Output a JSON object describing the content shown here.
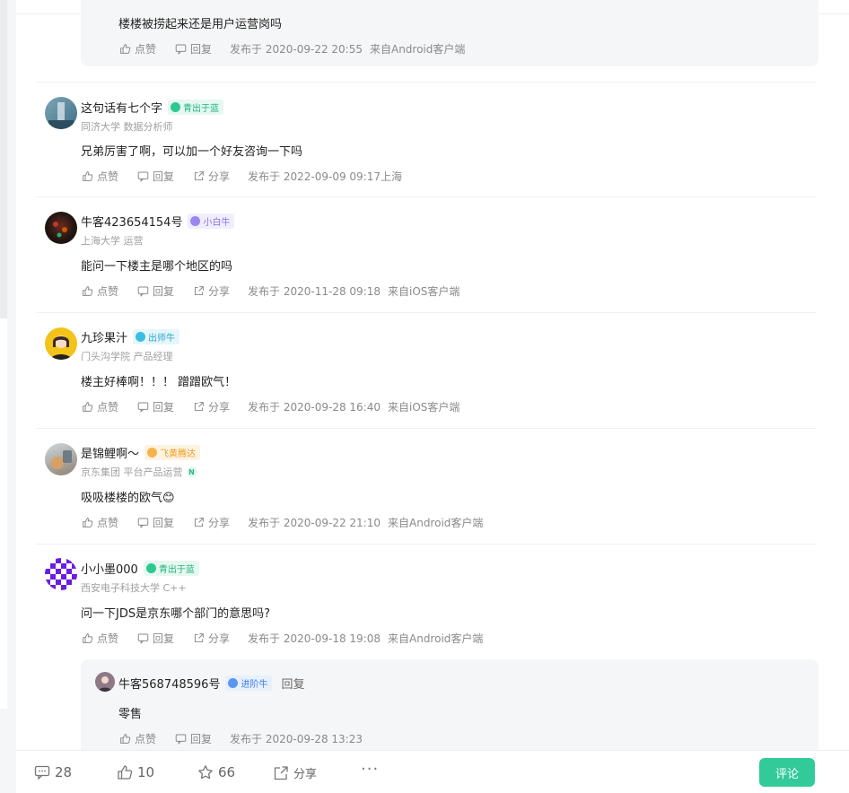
{
  "top_reply": {
    "text": "楼楼被捞起来还是用户运营岗吗",
    "like": "点赞",
    "reply": "回复",
    "time": "发布于 2020-09-22 20:55",
    "source": "来自Android客户端"
  },
  "comments": [
    {
      "name": "这句话有七个字",
      "badge": "青出于蓝",
      "sub": "同济大学 数据分析师",
      "text": "兄弟厉害了啊，可以加一个好友咨询一下吗",
      "like": "点赞",
      "reply": "回复",
      "share": "分享",
      "time": "发布于 2022-09-09 09:17",
      "source": "上海"
    },
    {
      "name": "牛客423654154号",
      "badge": "小白牛",
      "sub": "上海大学 运营",
      "text": "能问一下楼主是哪个地区的吗",
      "like": "点赞",
      "reply": "回复",
      "share": "分享",
      "time": "发布于 2020-11-28 09:18",
      "source": "来自iOS客户端"
    },
    {
      "name": "九珍果汁",
      "badge": "出师牛",
      "sub": "门头沟学院 产品经理",
      "text": "楼主好棒啊！！！ 蹭蹭欧气！",
      "like": "点赞",
      "reply": "回复",
      "share": "分享",
      "time": "发布于 2020-09-28 16:40",
      "source": "来自iOS客户端"
    },
    {
      "name": "是锦鲤啊～",
      "badge": "飞黄腾达",
      "sub": "京东集团  平台产品运营",
      "sub_tag": "N",
      "text": "吸吸楼楼的欧气😊",
      "like": "点赞",
      "reply": "回复",
      "share": "分享",
      "time": "发布于 2020-09-22 21:10",
      "source": "来自Android客户端"
    },
    {
      "name": "小小墨000",
      "badge": "青出于蓝",
      "sub": "西安电子科技大学 C++",
      "text": "问一下JDS是京东哪个部门的意思吗?",
      "like": "点赞",
      "reply": "回复",
      "share": "分享",
      "time": "发布于 2020-09-18 19:08",
      "source": "来自Android客户端"
    }
  ],
  "nested_reply": {
    "name": "牛客568748596号",
    "badge": "进阶牛",
    "reply_label": "回复",
    "text": "零售",
    "like": "点赞",
    "reply": "回复",
    "time": "发布于 2020-09-28 13:23"
  },
  "bottom_bar": {
    "comments_count": "28",
    "likes_count": "10",
    "stars_count": "66",
    "share_label": "分享",
    "more_label": "···",
    "comment_button": "评论"
  },
  "colors": {
    "accent": "#32ca99",
    "meta_text": "#8a8a8a"
  }
}
